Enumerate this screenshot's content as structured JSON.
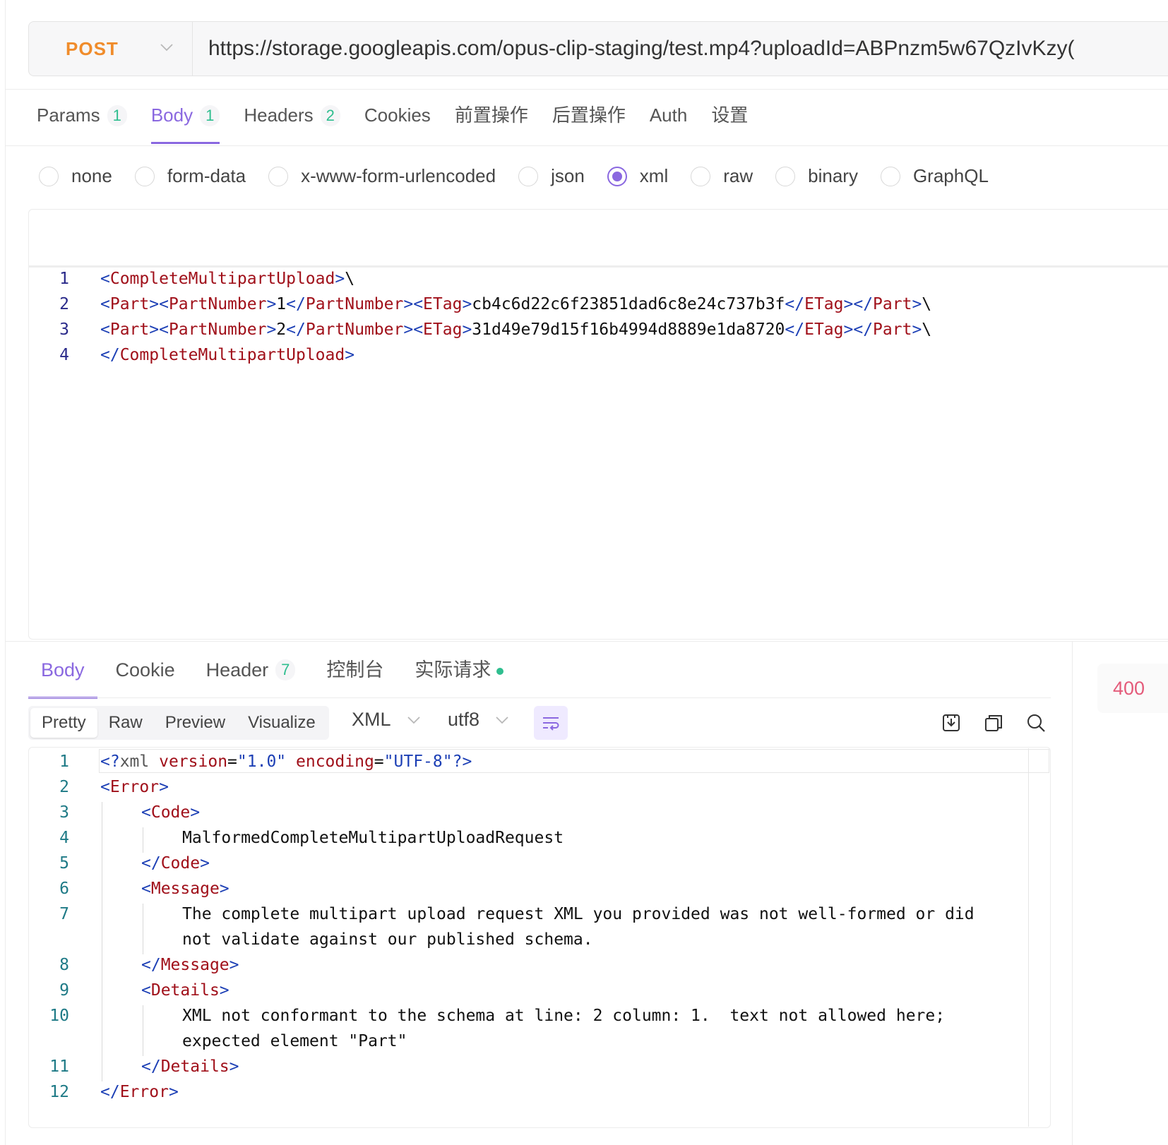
{
  "request": {
    "method": "POST",
    "url": "https://storage.googleapis.com/opus-clip-staging/test.mp4?uploadId=ABPnzm5w67QzIvKzy("
  },
  "request_tabs": [
    {
      "label": "Params",
      "count": "1"
    },
    {
      "label": "Body",
      "count": "1"
    },
    {
      "label": "Headers",
      "count": "2"
    },
    {
      "label": "Cookies",
      "count": ""
    },
    {
      "label": "前置操作",
      "count": ""
    },
    {
      "label": "后置操作",
      "count": ""
    },
    {
      "label": "Auth",
      "count": ""
    },
    {
      "label": "设置",
      "count": ""
    }
  ],
  "body_types": [
    "none",
    "form-data",
    "x-www-form-urlencoded",
    "json",
    "xml",
    "raw",
    "binary",
    "GraphQL"
  ],
  "selected_body_type": "xml",
  "request_body_lines": [
    {
      "n": "1"
    },
    {
      "n": "2"
    },
    {
      "n": "3"
    },
    {
      "n": "4"
    }
  ],
  "request_body": {
    "l1_tag": "CompleteMultipartUpload",
    "l1_tail": "\\",
    "part": "Part",
    "partnumber": "PartNumber",
    "etag": "ETag",
    "l2_num": "1",
    "l2_etag": "cb4c6d22c6f23851dad6c8e24c737b3f",
    "l3_num": "2",
    "l3_etag": "31d49e79d15f16b4994d8889e1da8720",
    "l4_tag": "CompleteMultipartUpload"
  },
  "response_tabs": [
    {
      "label": "Body",
      "count": ""
    },
    {
      "label": "Cookie",
      "count": ""
    },
    {
      "label": "Header",
      "count": "7"
    },
    {
      "label": "控制台",
      "count": ""
    },
    {
      "label": "实际请求",
      "count": ""
    }
  ],
  "status_code": "400",
  "view_modes": [
    "Pretty",
    "Raw",
    "Preview",
    "Visualize"
  ],
  "format": "XML",
  "encoding": "utf8",
  "response": {
    "decl_open": "<?",
    "decl_xml": "xml",
    "decl_version_attr": "version",
    "decl_version_val": "\"1.0\"",
    "decl_encoding_attr": "encoding",
    "decl_encoding_val": "\"UTF-8\"",
    "decl_close": "?>",
    "error": "Error",
    "code": "Code",
    "code_val": "MalformedCompleteMultipartUploadRequest",
    "message": "Message",
    "message_l1": "The complete multipart upload request XML you provided was not well-formed or did",
    "message_l2": "not validate against our published schema.",
    "details": "Details",
    "details_l1": "XML not conformant to the schema at line: 2 column: 1.  text not allowed here;",
    "details_l2": "expected element \"Part\""
  },
  "response_line_numbers": [
    "1",
    "2",
    "3",
    "4",
    "5",
    "6",
    "7",
    "8",
    "9",
    "10",
    "11",
    "12"
  ],
  "colors": {
    "accent": "#8a68e0",
    "method": "#f08c2b",
    "count": "#2fbe8f",
    "status_error": "#e45b7a"
  }
}
